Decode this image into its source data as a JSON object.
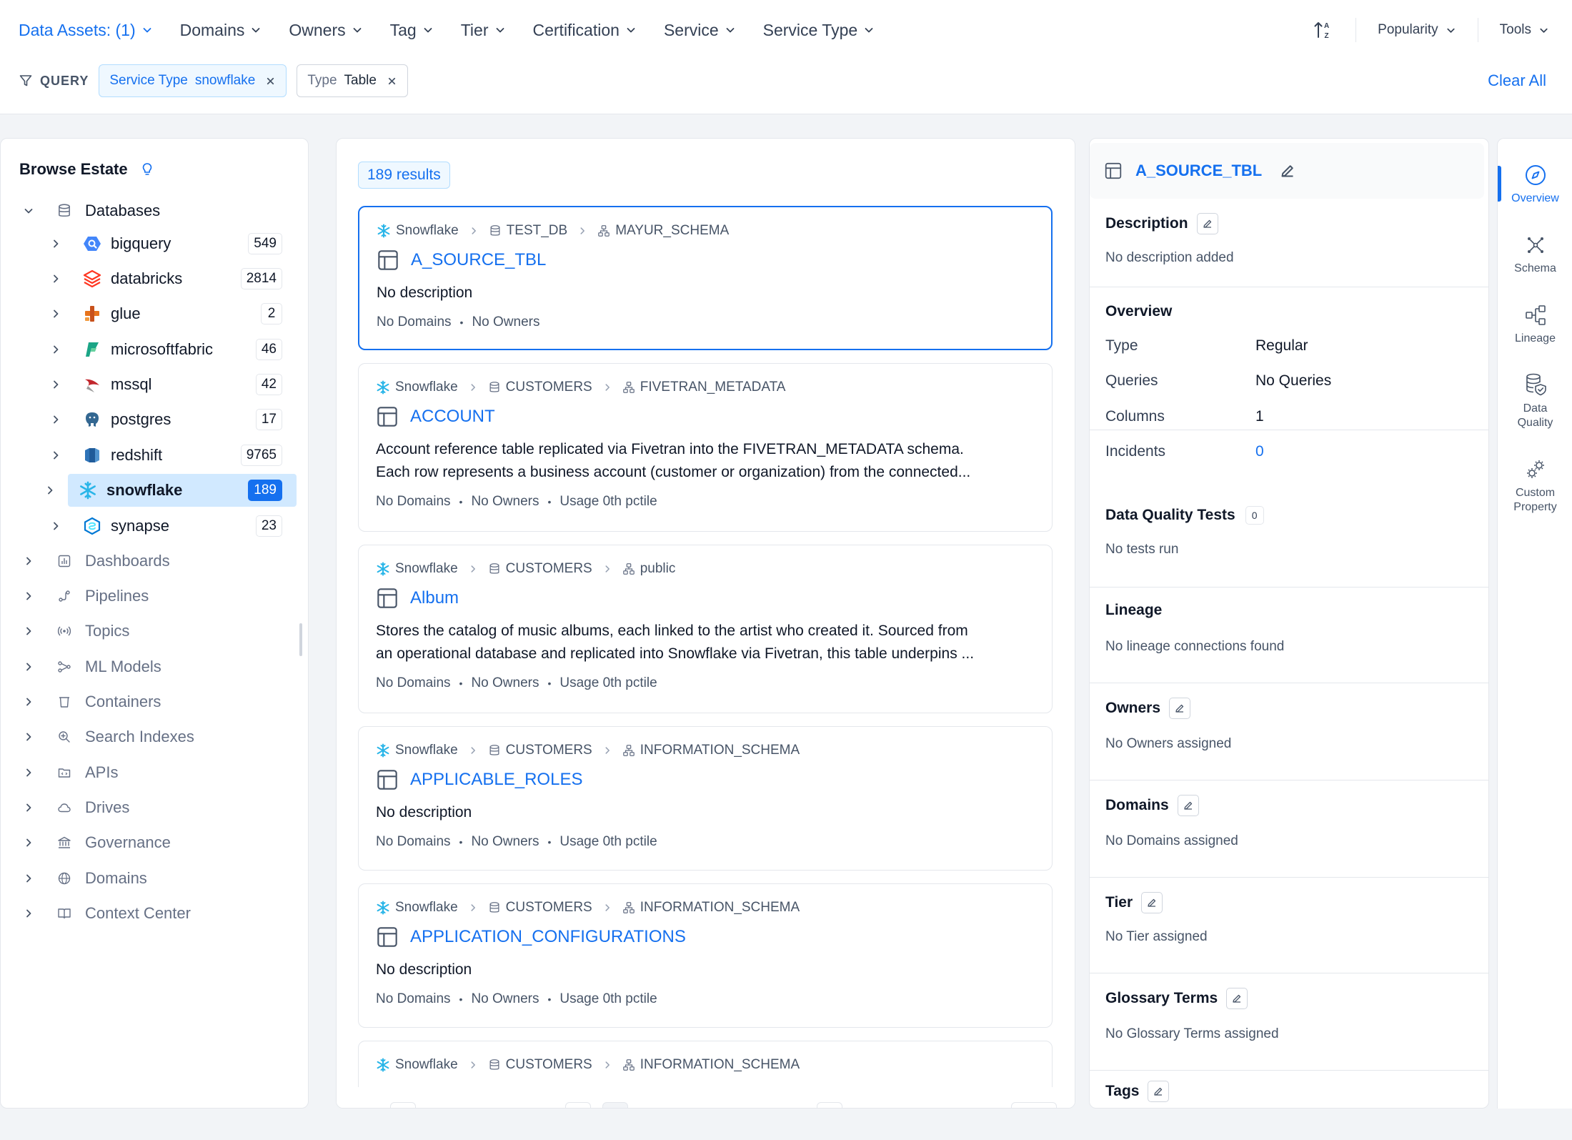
{
  "filters": {
    "data_assets": "Data Assets: (1)",
    "domains": "Domains",
    "owners": "Owners",
    "tag": "Tag",
    "tier": "Tier",
    "certification": "Certification",
    "service": "Service",
    "service_type": "Service Type"
  },
  "tools": {
    "sort": "Popularity",
    "tools": "Tools"
  },
  "query": {
    "label": "QUERY",
    "chips": [
      {
        "key": "Service Type",
        "value": "snowflake"
      },
      {
        "key": "Type",
        "value": "Table"
      }
    ],
    "clear_all": "Clear All"
  },
  "browse": {
    "title": "Browse Estate",
    "databases": "Databases",
    "services": [
      {
        "label": "bigquery",
        "count": "549"
      },
      {
        "label": "databricks",
        "count": "2814"
      },
      {
        "label": "glue",
        "count": "2"
      },
      {
        "label": "microsoftfabric",
        "count": "46"
      },
      {
        "label": "mssql",
        "count": "42"
      },
      {
        "label": "postgres",
        "count": "17"
      },
      {
        "label": "redshift",
        "count": "9765"
      },
      {
        "label": "snowflake",
        "count": "189"
      },
      {
        "label": "synapse",
        "count": "23"
      }
    ],
    "categories": [
      "Dashboards",
      "Pipelines",
      "Topics",
      "ML Models",
      "Containers",
      "Search Indexes",
      "APIs",
      "Drives",
      "Governance",
      "Domains",
      "Context Center"
    ]
  },
  "results": {
    "count": "189 results",
    "cards": [
      {
        "service": "Snowflake",
        "db": "TEST_DB",
        "schema": "MAYUR_SCHEMA",
        "title": "A_SOURCE_TBL",
        "desc1": "No description",
        "desc2": "",
        "domains": "No Domains",
        "owners": "No Owners",
        "usage": ""
      },
      {
        "service": "Snowflake",
        "db": "CUSTOMERS",
        "schema": "FIVETRAN_METADATA",
        "title": "ACCOUNT",
        "desc1": "Account reference table replicated via Fivetran into the FIVETRAN_METADATA schema.",
        "desc2": "Each row represents a business account (customer or organization) from the connected...",
        "domains": "No Domains",
        "owners": "No Owners",
        "usage": "Usage 0th pctile"
      },
      {
        "service": "Snowflake",
        "db": "CUSTOMERS",
        "schema": "public",
        "title": "Album",
        "desc1": "Stores the catalog of music albums, each linked to the artist who created it. Sourced from",
        "desc2": "an operational database and replicated into Snowflake via Fivetran, this table underpins ...",
        "domains": "No Domains",
        "owners": "No Owners",
        "usage": "Usage 0th pctile"
      },
      {
        "service": "Snowflake",
        "db": "CUSTOMERS",
        "schema": "INFORMATION_SCHEMA",
        "title": "APPLICABLE_ROLES",
        "desc1": "No description",
        "desc2": "",
        "domains": "No Domains",
        "owners": "No Owners",
        "usage": "Usage 0th pctile"
      },
      {
        "service": "Snowflake",
        "db": "CUSTOMERS",
        "schema": "INFORMATION_SCHEMA",
        "title": "APPLICATION_CONFIGURATIONS",
        "desc1": "No description",
        "desc2": "",
        "domains": "No Domains",
        "owners": "No Owners",
        "usage": "Usage 0th pctile"
      },
      {
        "service": "Snowflake",
        "db": "CUSTOMERS",
        "schema": "INFORMATION_SCHEMA",
        "title": "",
        "desc1": "",
        "desc2": "",
        "domains": "",
        "owners": "",
        "usage": ""
      }
    ]
  },
  "detail": {
    "title": "A_SOURCE_TBL",
    "description": {
      "title": "Description",
      "text": "No description added"
    },
    "overview": {
      "title": "Overview",
      "rows": [
        {
          "k": "Type",
          "v": "Regular"
        },
        {
          "k": "Queries",
          "v": "No Queries"
        },
        {
          "k": "Columns",
          "v": "1"
        },
        {
          "k": "Incidents",
          "v": "0"
        }
      ]
    },
    "dq": {
      "title": "Data Quality Tests",
      "count": "0",
      "text": "No tests run"
    },
    "lineage": {
      "title": "Lineage",
      "text": "No lineage connections found"
    },
    "owners": {
      "title": "Owners",
      "text": "No Owners assigned"
    },
    "domains": {
      "title": "Domains",
      "text": "No Domains assigned"
    },
    "tier": {
      "title": "Tier",
      "text": "No Tier assigned"
    },
    "glossary": {
      "title": "Glossary Terms",
      "text": "No Glossary Terms assigned"
    },
    "tags": {
      "title": "Tags"
    }
  },
  "rail": {
    "overview": "Overview",
    "schema": "Schema",
    "lineage": "Lineage",
    "dq_1": "Data",
    "dq_2": "Quality",
    "cp_1": "Custom",
    "cp_2": "Property"
  },
  "colors": {
    "accent": "#1570ef",
    "selected_bg": "#d1e9ff",
    "border": "#e4e7ec"
  }
}
